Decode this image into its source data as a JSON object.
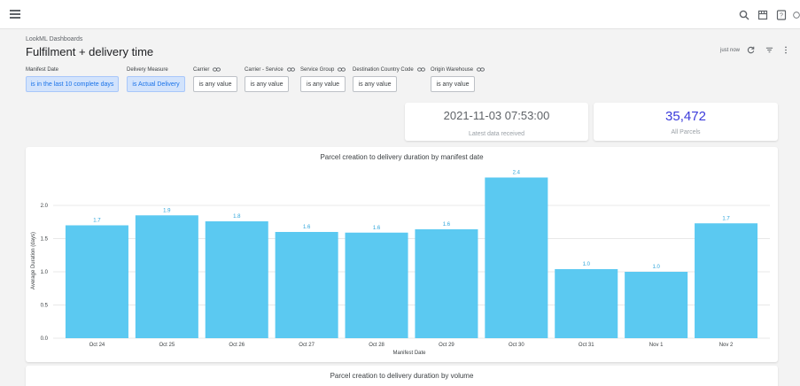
{
  "header": {
    "breadcrumb": "LookML Dashboards",
    "title": "Fulfilment + delivery time",
    "refresh_text": "just now"
  },
  "filters": [
    {
      "label": "Manifest Date",
      "value": "is in the last 10 complete days",
      "active": true,
      "linked": false
    },
    {
      "label": "Delivery Measure",
      "value": "is Actual Delivery",
      "active": true,
      "linked": false
    },
    {
      "label": "Carrier",
      "value": "is any value",
      "active": false,
      "linked": true
    },
    {
      "label": "Carrier - Service",
      "value": "is any value",
      "active": false,
      "linked": true
    },
    {
      "label": "Service Group",
      "value": "is any value",
      "active": false,
      "linked": true
    },
    {
      "label": "Destination Country Code",
      "value": "is any value",
      "active": false,
      "linked": true
    },
    {
      "label": "Origin Warehouse",
      "value": "is any value",
      "active": false,
      "linked": true
    }
  ],
  "kpis": {
    "latest": {
      "value": "2021-11-03 07:53:00",
      "label": "Latest data received"
    },
    "parcels": {
      "value": "35,472",
      "label": "All Parcels"
    }
  },
  "chart_data": {
    "type": "bar",
    "title": "Parcel creation to delivery duration by manifest date",
    "xlabel": "Manifest Date",
    "ylabel": "Average Duration (days)",
    "categories": [
      "Oct 24",
      "Oct 25",
      "Oct 26",
      "Oct 27",
      "Oct 28",
      "Oct 29",
      "Oct 30",
      "Oct 31",
      "Nov 1",
      "Nov 2"
    ],
    "values": [
      1.7,
      1.85,
      1.76,
      1.6,
      1.59,
      1.64,
      2.42,
      1.04,
      1.0,
      1.73
    ],
    "value_labels": [
      "1.7",
      "1.9",
      "1.8",
      "1.6",
      "1.6",
      "1.6",
      "2.4",
      "1.0",
      "1.0",
      "1.7"
    ],
    "yticks": [
      "0.0",
      "0.5",
      "1.0",
      "1.5",
      "2.0"
    ],
    "ytick_values": [
      0,
      0.5,
      1.0,
      1.5,
      2.0
    ],
    "ylim": [
      0,
      2.6
    ],
    "bar_color": "#5bc9f1",
    "label_color": "#2ea5db",
    "grid": true
  },
  "chart2": {
    "title": "Parcel creation to delivery duration by volume"
  },
  "colors": {
    "accent": "#1a73e8",
    "kpi_blue": "#3b3bdb"
  },
  "icons": [
    "menu-icon",
    "search-icon",
    "store-icon",
    "help-icon",
    "account-icon",
    "refresh-icon",
    "filter-icon",
    "more-vert-icon",
    "link-icon"
  ]
}
